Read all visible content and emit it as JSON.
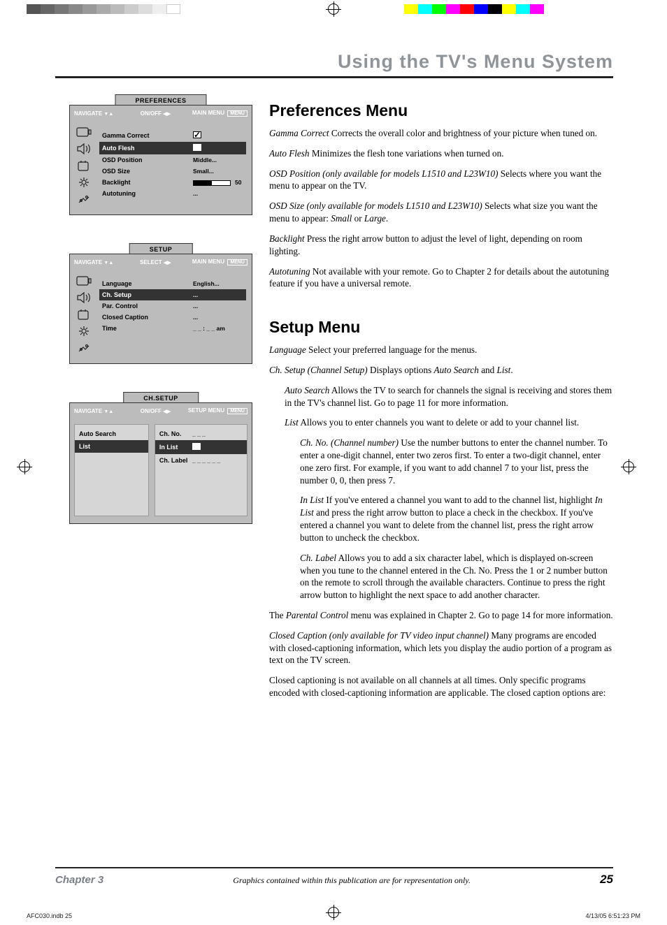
{
  "page_header": "Using the TV's Menu System",
  "osd_prefs": {
    "title": "PREFERENCES",
    "nav": "NAVIGATE",
    "mid": "ON/OFF",
    "main": "MAIN MENU",
    "menu_btn": "MENU",
    "rows": [
      {
        "key": "Gamma Correct",
        "val_type": "check",
        "checked": true,
        "hl": false
      },
      {
        "key": "Auto Flesh",
        "val_type": "check",
        "checked": true,
        "hl": true
      },
      {
        "key": "OSD Position",
        "val_type": "text",
        "val": "Middle...",
        "hl": false
      },
      {
        "key": "OSD Size",
        "val_type": "text",
        "val": "Small...",
        "hl": false
      },
      {
        "key": "Backlight",
        "val_type": "slider",
        "val": "50",
        "hl": false
      },
      {
        "key": "Autotuning",
        "val_type": "text",
        "val": "...",
        "hl": false
      }
    ]
  },
  "osd_setup": {
    "title": "SETUP",
    "nav": "NAVIGATE",
    "mid": "SELECT",
    "main": "MAIN MENU",
    "menu_btn": "MENU",
    "rows": [
      {
        "key": "Language",
        "val": "English...",
        "hl": false
      },
      {
        "key": "Ch. Setup",
        "val": "...",
        "hl": true
      },
      {
        "key": "Par. Control",
        "val": "...",
        "hl": false
      },
      {
        "key": "Closed Caption",
        "val": "...",
        "hl": false
      },
      {
        "key": "Time",
        "val": "_ _ : _ _ am",
        "hl": false
      }
    ]
  },
  "osd_chsetup": {
    "title": "CH.SETUP",
    "nav": "NAVIGATE",
    "mid": "ON/OFF",
    "main": "SETUP MENU",
    "menu_btn": "MENU",
    "left": [
      {
        "key": "Auto Search",
        "hl": false
      },
      {
        "key": "List",
        "hl": true
      }
    ],
    "right": [
      {
        "key": "Ch. No.",
        "val": "_ _ _",
        "hl": false
      },
      {
        "key": "In List",
        "val_type": "check",
        "checked": true,
        "hl": true
      },
      {
        "key": "Ch. Label",
        "val": "_ _ _ _ _ _",
        "hl": false
      }
    ]
  },
  "sections": {
    "prefs_title": "Preferences Menu",
    "prefs": [
      {
        "em": "Gamma Correct",
        "txt": "   Corrects the overall color and brightness of your picture when tuned on."
      },
      {
        "em": "Auto Flesh",
        "txt": "   Minimizes the flesh tone variations when turned on."
      },
      {
        "em": "OSD Position (only available for models L1510 and L23W10)",
        "txt": "   Selects where you want the menu to appear on the TV."
      },
      {
        "em": "OSD Size (only available for models L1510 and L23W10)",
        "txt": "   Selects what size you want the menu to appear: ",
        "tail_em": "Small",
        "tail_mid": " or ",
        "tail_em2": "Large",
        "tail_end": "."
      },
      {
        "em": "Backlight",
        "txt": "   Press the right arrow button to adjust the level of light, depending on room lighting."
      },
      {
        "em": "Autotuning",
        "txt": "   Not available with your remote. Go to Chapter 2 for details about the autotuning feature if you have a universal remote."
      }
    ],
    "setup_title": "Setup Menu",
    "setup_lang": {
      "em": "Language",
      "txt": "   Select your preferred language for the menus."
    },
    "setup_ch": {
      "em": "Ch. Setup (Channel Setup)",
      "txt": "   Displays options ",
      "em2": "Auto Search",
      "mid": " and ",
      "em3": "List",
      "end": "."
    },
    "setup_auto": {
      "em": "Auto Search",
      "txt": "   Allows the TV to search for channels the signal is receiving and stores them in the TV's channel list. Go to page 11 for more information."
    },
    "setup_list": {
      "em": "List",
      "txt": "   Allows you to enter channels you want to delete or add to your channel list."
    },
    "setup_chno": {
      "em": "Ch. No. (Channel number)",
      "txt": "   Use the number buttons to enter the channel number. To enter a one-digit channel, enter two zeros first. To enter a two-digit channel, enter one zero first. For example, if you want to add channel 7 to your list, press the number 0, 0, then press 7."
    },
    "setup_inlist": {
      "em": "In List",
      "txt": "   If you've entered a channel you want to add to the channel list, highlight ",
      "em2": "In List",
      "txt2": " and press the right arrow button to place a check in the checkbox. If you've entered a channel you want to delete from the channel list, press the right arrow button to uncheck the checkbox."
    },
    "setup_chlabel": {
      "em": "Ch. Label",
      "txt": "   Allows you to add a six character label, which is displayed on-screen when you tune to the channel entered in the Ch. No. Press the 1 or 2 number button on the remote to scroll through the available characters. Continue to press the right arrow button to highlight the next space to add another character."
    },
    "setup_parental": {
      "pre": "The ",
      "em": "Parental Control",
      "txt": " menu was explained in Chapter 2. Go to page 14 for more information."
    },
    "setup_cc1": {
      "em": "Closed Caption (only available for TV video input channel)",
      "txt": "   Many programs are encoded with closed-captioning information, which lets you display the audio portion of a program as text on the TV screen."
    },
    "setup_cc2": "Closed captioning is not available on all channels at all times. Only specific programs encoded with closed-captioning information are applicable. The closed caption options are:"
  },
  "footer": {
    "chapter": "Chapter 3",
    "note": "Graphics contained within this publication are for representation only.",
    "page": "25"
  },
  "print": {
    "left": "AFC030.indb   25",
    "right": "4/13/05   6:51:23 PM"
  },
  "colors_left": [
    "#555",
    "#666",
    "#777",
    "#888",
    "#999",
    "#aaa",
    "#bbb",
    "#ccc",
    "#ddd",
    "#eee",
    "#fff"
  ],
  "colors_right": [
    "#fff",
    "#ff0",
    "#0ff",
    "#0f0",
    "#f0f",
    "#f00",
    "#00f",
    "#000",
    "#ff0",
    "#0ff",
    "#f0f",
    "#fff"
  ]
}
